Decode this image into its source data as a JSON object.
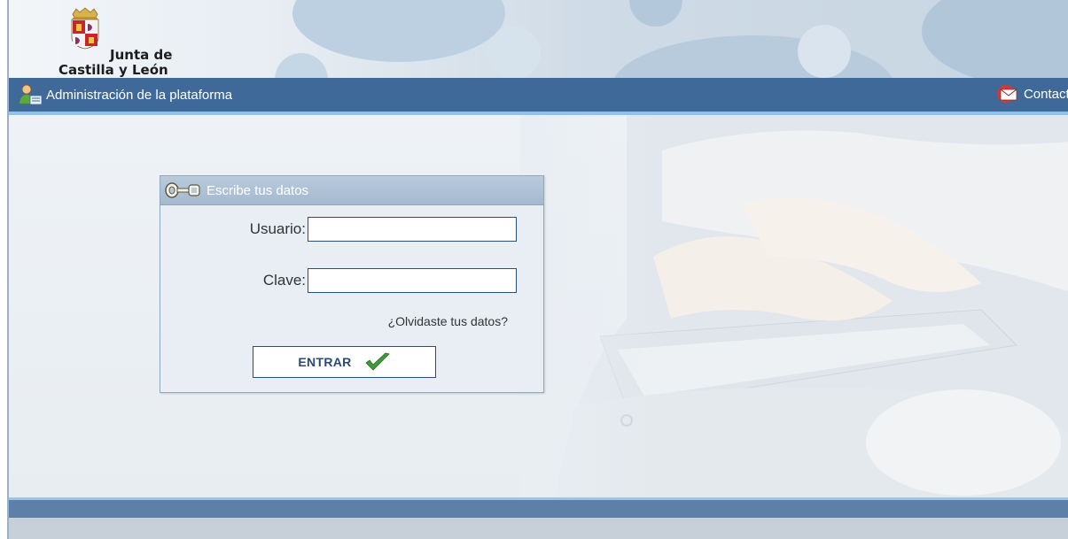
{
  "header": {
    "logo_line1": "Junta de",
    "logo_line2": "Castilla y León"
  },
  "navbar": {
    "admin_label": "Administración de la plataforma",
    "contact_label": "Contacto"
  },
  "login": {
    "title": "Escribe tus datos",
    "user_label": "Usuario:",
    "user_value": "",
    "password_label": "Clave:",
    "password_value": "",
    "forgot_link": "¿Olvidaste tus datos?",
    "submit_label": "ENTRAR"
  },
  "icons": {
    "admin": "admin-user-icon",
    "contact": "envelope-icon",
    "key": "key-icon",
    "check": "checkmark-icon"
  },
  "colors": {
    "navbar": "#3f6998",
    "navbar_accent": "#8fc3ec",
    "button_text": "#2b4a72",
    "input_border": "#2a4d7a"
  }
}
